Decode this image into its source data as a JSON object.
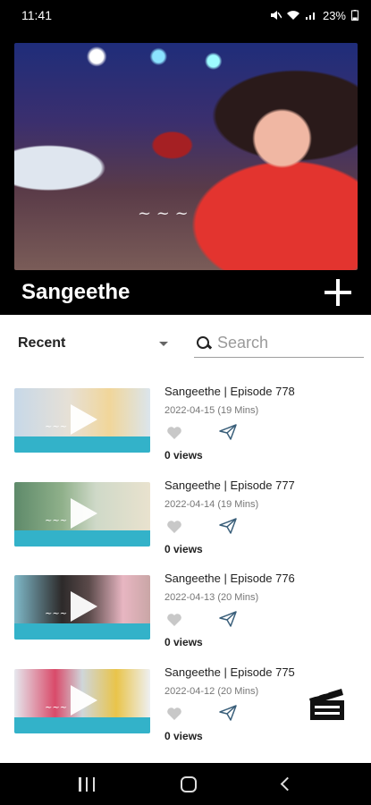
{
  "status": {
    "time": "11:41",
    "battery": "23%"
  },
  "header": {
    "title": "Sangeethe"
  },
  "filter": {
    "selected": "Recent",
    "search_placeholder": "Search"
  },
  "episodes": [
    {
      "title": "Sangeethe | Episode 778",
      "meta": "2022-04-15 (19 Mins)",
      "views": "0 views"
    },
    {
      "title": "Sangeethe | Episode 777",
      "meta": "2022-04-14 (19 Mins)",
      "views": "0 views"
    },
    {
      "title": "Sangeethe | Episode 776",
      "meta": "2022-04-13 (20 Mins)",
      "views": "0 views"
    },
    {
      "title": "Sangeethe | Episode 775",
      "meta": "2022-04-12 (20 Mins)",
      "views": "0 views"
    }
  ],
  "icons": {
    "add": "plus-icon",
    "search": "search-icon",
    "like": "heart-icon",
    "share": "send-icon",
    "clapperboard": "clapperboard-icon",
    "play": "play-icon"
  },
  "colors": {
    "header_bg": "#000000",
    "accent": "#33b2c9"
  }
}
